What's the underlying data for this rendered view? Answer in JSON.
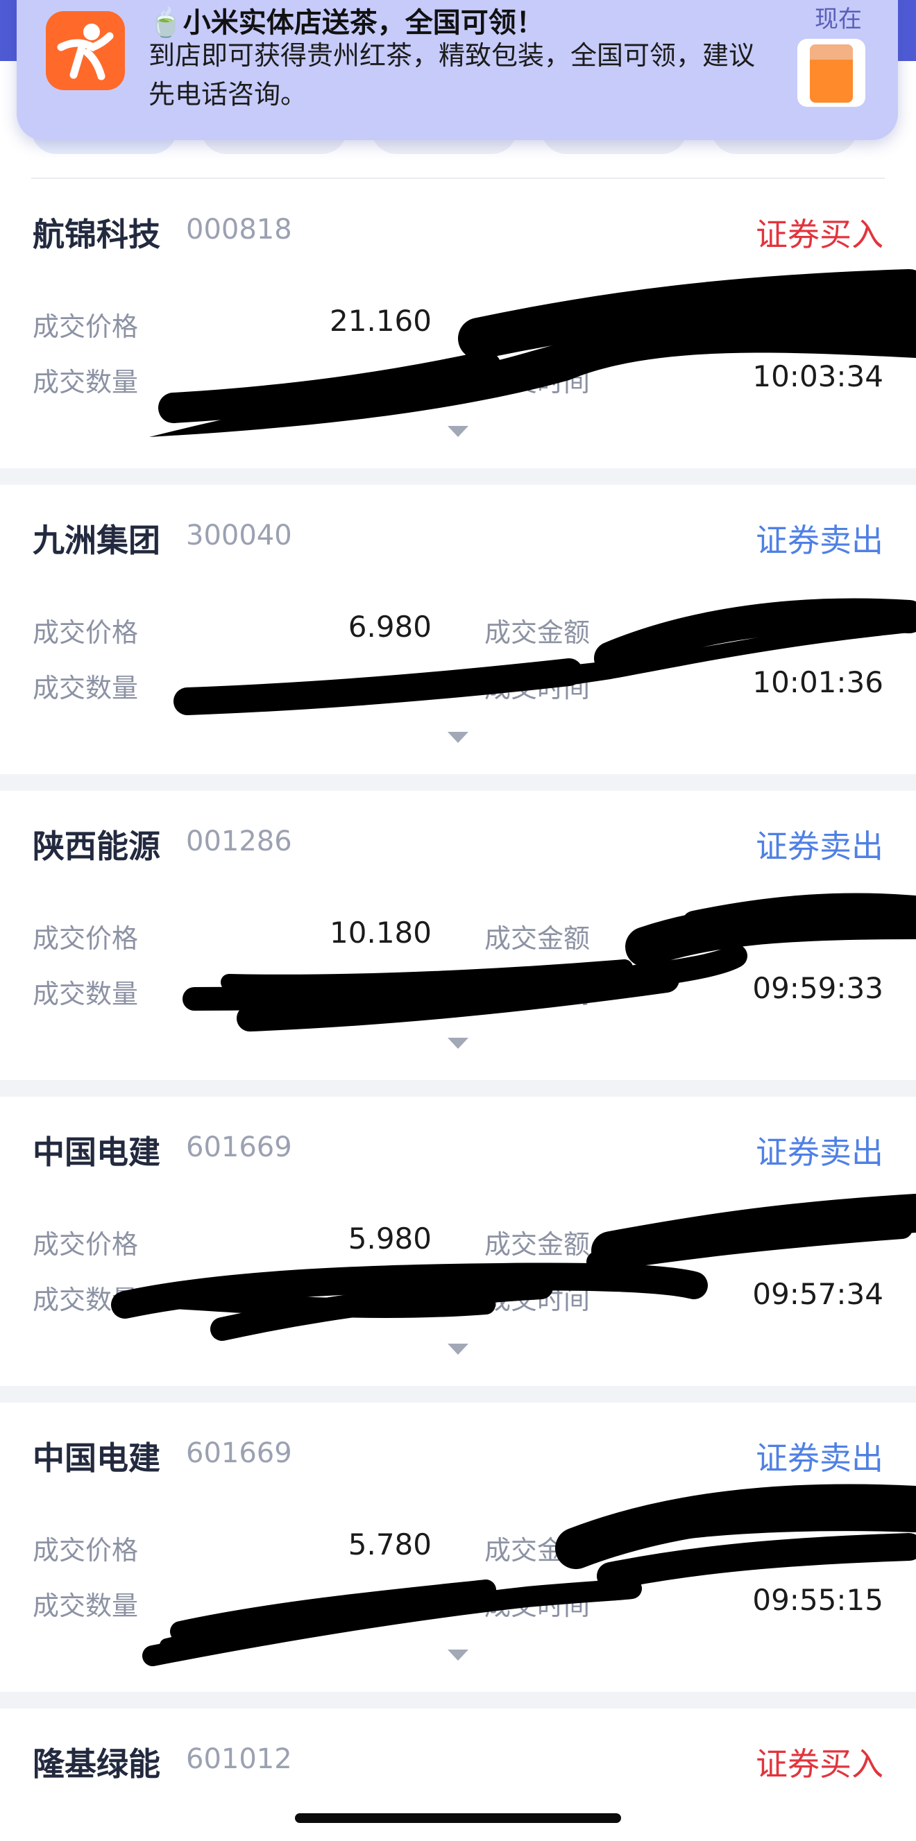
{
  "notification": {
    "app_icon": "dianping-person-icon",
    "title": "🍵小米实体店送茶，全国可领！",
    "body": "到店即可获得贵州红茶，精致包装，全国可领，建议先电话咨询。",
    "time": "现在",
    "thumbnail": "tea-box-image"
  },
  "labels": {
    "price": "成交价格",
    "amount": "成交金额",
    "quantity": "成交数量",
    "time": "成交时间"
  },
  "colors": {
    "buy": "#e2343d",
    "sell": "#4f80e4",
    "label": "#8c92a3",
    "name": "#232a3f",
    "header": "#4f5bd5"
  },
  "records": [
    {
      "name": "航锦科技",
      "code": "000818",
      "type": "证券买入",
      "side": "buy",
      "price": "21.160",
      "time": "10:03:34"
    },
    {
      "name": "九洲集团",
      "code": "300040",
      "type": "证券卖出",
      "side": "sell",
      "price": "6.980",
      "time": "10:01:36"
    },
    {
      "name": "陕西能源",
      "code": "001286",
      "type": "证券卖出",
      "side": "sell",
      "price": "10.180",
      "time": "09:59:33"
    },
    {
      "name": "中国电建",
      "code": "601669",
      "type": "证券卖出",
      "side": "sell",
      "price": "5.980",
      "time": "09:57:34"
    },
    {
      "name": "中国电建",
      "code": "601669",
      "type": "证券卖出",
      "side": "sell",
      "price": "5.780",
      "time": "09:55:15"
    },
    {
      "name": "隆基绿能",
      "code": "601012",
      "type": "证券买入",
      "side": "buy"
    }
  ]
}
